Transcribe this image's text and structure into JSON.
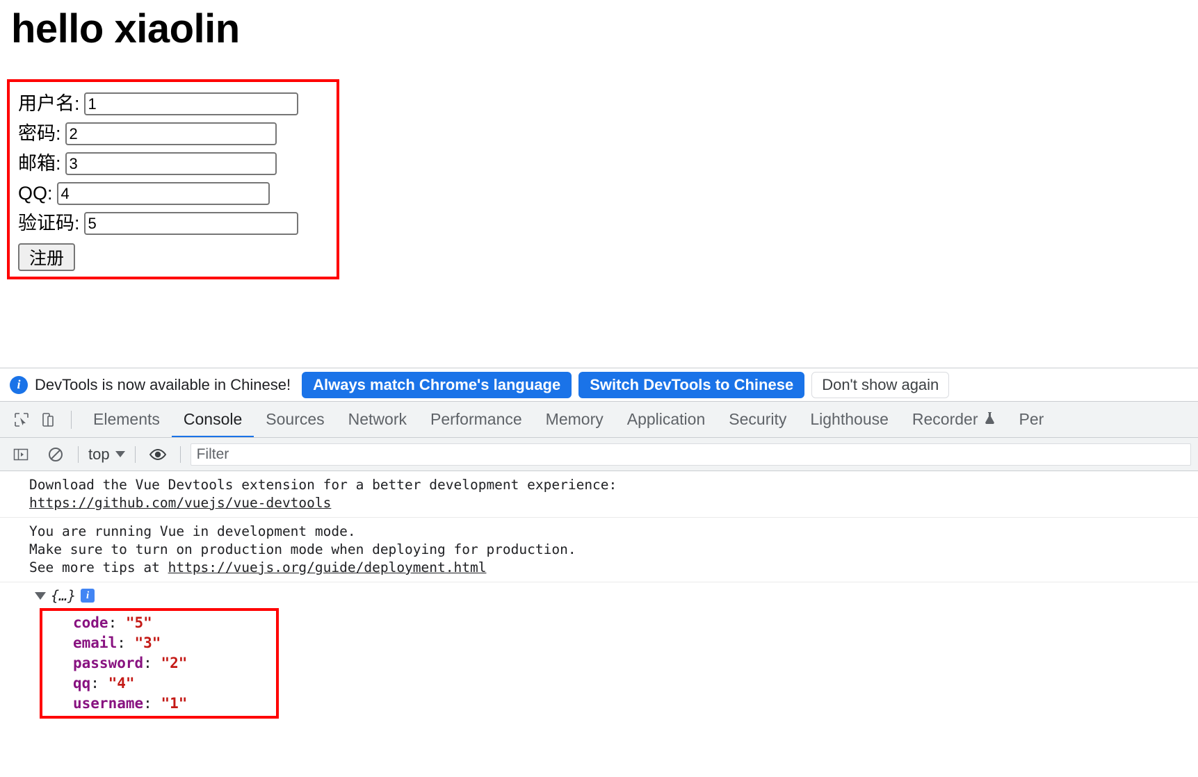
{
  "page": {
    "heading": "hello xiaolin",
    "form": {
      "rows": [
        {
          "label": "用户名:",
          "value": "1",
          "name": "username"
        },
        {
          "label": "密码:",
          "value": "2",
          "name": "password"
        },
        {
          "label": "邮箱:",
          "value": "3",
          "name": "email"
        },
        {
          "label": "QQ:",
          "value": "4",
          "name": "qq"
        },
        {
          "label": "验证码:",
          "value": "5",
          "name": "code"
        }
      ],
      "submit_label": "注册",
      "highlight_color": "#ff0000"
    }
  },
  "devtools": {
    "infobar": {
      "icon": "info-icon",
      "message": "DevTools is now available in Chinese!",
      "primary_button": "Always match Chrome's language",
      "secondary_button": "Switch DevTools to Chinese",
      "dismiss_button": "Don't show again",
      "accent_color": "#1a73e8"
    },
    "tabs": [
      {
        "label": "Elements",
        "active": false
      },
      {
        "label": "Console",
        "active": true
      },
      {
        "label": "Sources",
        "active": false
      },
      {
        "label": "Network",
        "active": false
      },
      {
        "label": "Performance",
        "active": false
      },
      {
        "label": "Memory",
        "active": false
      },
      {
        "label": "Application",
        "active": false
      },
      {
        "label": "Security",
        "active": false
      },
      {
        "label": "Lighthouse",
        "active": false
      },
      {
        "label": "Recorder",
        "active": false,
        "experiment": true
      },
      {
        "label": "Per",
        "active": false
      }
    ],
    "tab_icons": [
      "inspect-element-icon",
      "device-toolbar-icon"
    ],
    "console_toolbar": {
      "sidebar_toggle": "console-sidebar-icon",
      "clear_label": "clear-console-icon",
      "context": "top",
      "eye_label": "live-expression-icon",
      "filter_placeholder": "Filter",
      "filter_value": ""
    },
    "console": {
      "messages": [
        {
          "lines": [
            {
              "text": "Download the Vue Devtools extension for a better development experience:",
              "link": false
            },
            {
              "text": "https://github.com/vuejs/vue-devtools",
              "link": true
            }
          ]
        },
        {
          "lines": [
            {
              "text": "You are running Vue in development mode.",
              "link": false
            },
            {
              "text": "Make sure to turn on production mode when deploying for production.",
              "link": false
            },
            {
              "text": "See more tips at ",
              "link": false,
              "suffix_link": "https://vuejs.org/guide/deployment.html"
            }
          ]
        }
      ],
      "object": {
        "collapsed_label": "{…}",
        "info_badge": "i",
        "properties": [
          {
            "key": "code",
            "value": "\"5\""
          },
          {
            "key": "email",
            "value": "\"3\""
          },
          {
            "key": "password",
            "value": "\"2\""
          },
          {
            "key": "qq",
            "value": "\"4\""
          },
          {
            "key": "username",
            "value": "\"1\""
          }
        ],
        "highlight_color": "#ff0000"
      }
    }
  }
}
